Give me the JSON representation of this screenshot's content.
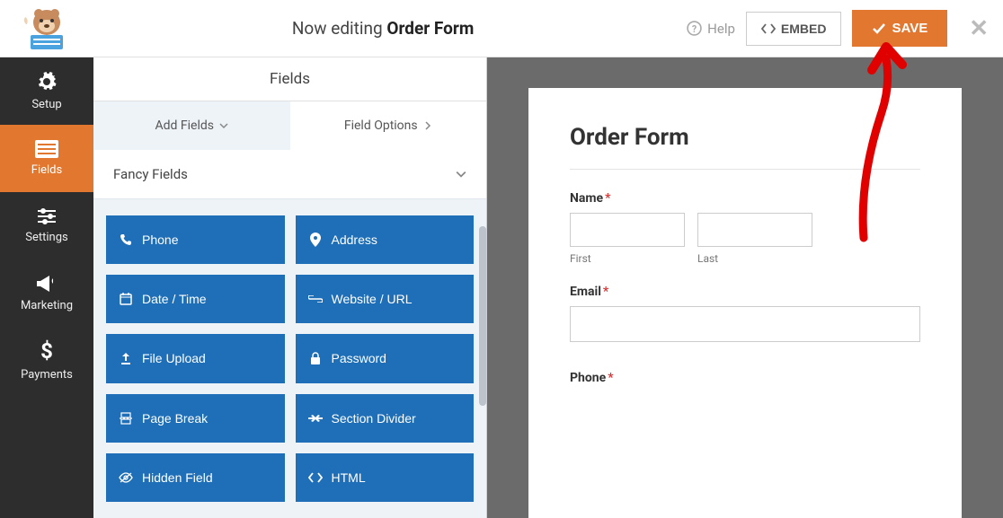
{
  "header": {
    "title_prefix": "Now editing ",
    "form_name": "Order Form",
    "help_label": "Help",
    "embed_label": "EMBED",
    "save_label": "SAVE",
    "close_symbol": "✕"
  },
  "sidebar": {
    "items": [
      {
        "label": "Setup",
        "icon": "gear"
      },
      {
        "label": "Fields",
        "icon": "form",
        "active": true
      },
      {
        "label": "Settings",
        "icon": "sliders"
      },
      {
        "label": "Marketing",
        "icon": "megaphone"
      },
      {
        "label": "Payments",
        "icon": "dollar"
      }
    ]
  },
  "panel": {
    "header": "Fields",
    "tabs": [
      {
        "label": "Add Fields",
        "active": true,
        "chevron": "down"
      },
      {
        "label": "Field Options",
        "chevron": "right"
      }
    ],
    "group_label": "Fancy Fields",
    "fields": [
      {
        "label": "Phone",
        "icon": "phone"
      },
      {
        "label": "Address",
        "icon": "pin"
      },
      {
        "label": "Date / Time",
        "icon": "calendar"
      },
      {
        "label": "Website / URL",
        "icon": "link"
      },
      {
        "label": "File Upload",
        "icon": "upload"
      },
      {
        "label": "Password",
        "icon": "lock"
      },
      {
        "label": "Page Break",
        "icon": "pagebreak"
      },
      {
        "label": "Section Divider",
        "icon": "divider"
      },
      {
        "label": "Hidden Field",
        "icon": "eye-off"
      },
      {
        "label": "HTML",
        "icon": "code"
      }
    ]
  },
  "preview": {
    "form_title": "Order Form",
    "name_label": "Name",
    "first_sublabel": "First",
    "last_sublabel": "Last",
    "email_label": "Email",
    "phone_label": "Phone"
  }
}
